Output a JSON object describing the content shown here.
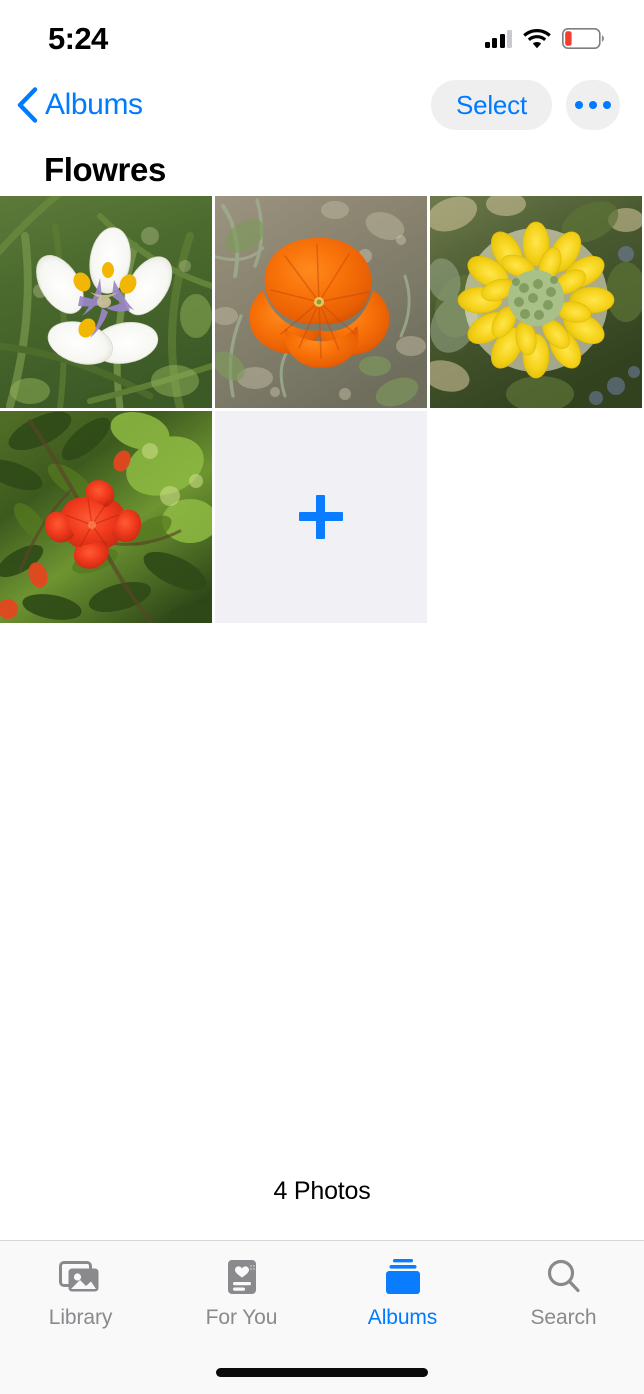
{
  "status_bar": {
    "time": "5:24",
    "signal_icon": "cellular-signal-icon",
    "signal_bars_filled": 3,
    "signal_bars_total": 4,
    "wifi_icon": "wifi-icon",
    "battery_icon": "battery-low-icon",
    "battery_level_percent": 15,
    "battery_color": "#F03E2F"
  },
  "nav_bar": {
    "back_label": "Albums",
    "back_icon": "chevron-left-icon",
    "select_label": "Select",
    "more_icon": "ellipsis-icon",
    "accent_color": "#007AFF",
    "pill_background": "#EFEFF0"
  },
  "album": {
    "title": "Flowres",
    "photo_count_label": "4 Photos"
  },
  "grid": {
    "add_tile_label": "+",
    "add_tile_icon": "plus-icon",
    "add_tile_background": "#F1F1F5",
    "items": [
      {
        "name": "photo-white-iris",
        "alt": "White iris flower with purple and yellow markings on green grass"
      },
      {
        "name": "photo-orange-poppy",
        "alt": "Orange California poppy on sandy gravel ground"
      },
      {
        "name": "photo-yellow-flower",
        "alt": "Yellow layered flower with green center"
      },
      {
        "name": "photo-red-flower",
        "alt": "Red pomegranate blossom among green leaves"
      }
    ]
  },
  "tab_bar": {
    "active_index": 2,
    "active_color": "#007AFF",
    "inactive_color": "#8A8A8E",
    "tabs": [
      {
        "label": "Library",
        "icon": "photo-stack-icon"
      },
      {
        "label": "For You",
        "icon": "heart-card-icon"
      },
      {
        "label": "Albums",
        "icon": "albums-stack-icon"
      },
      {
        "label": "Search",
        "icon": "magnifier-icon"
      }
    ]
  },
  "home_indicator": {
    "name": "home-indicator"
  }
}
